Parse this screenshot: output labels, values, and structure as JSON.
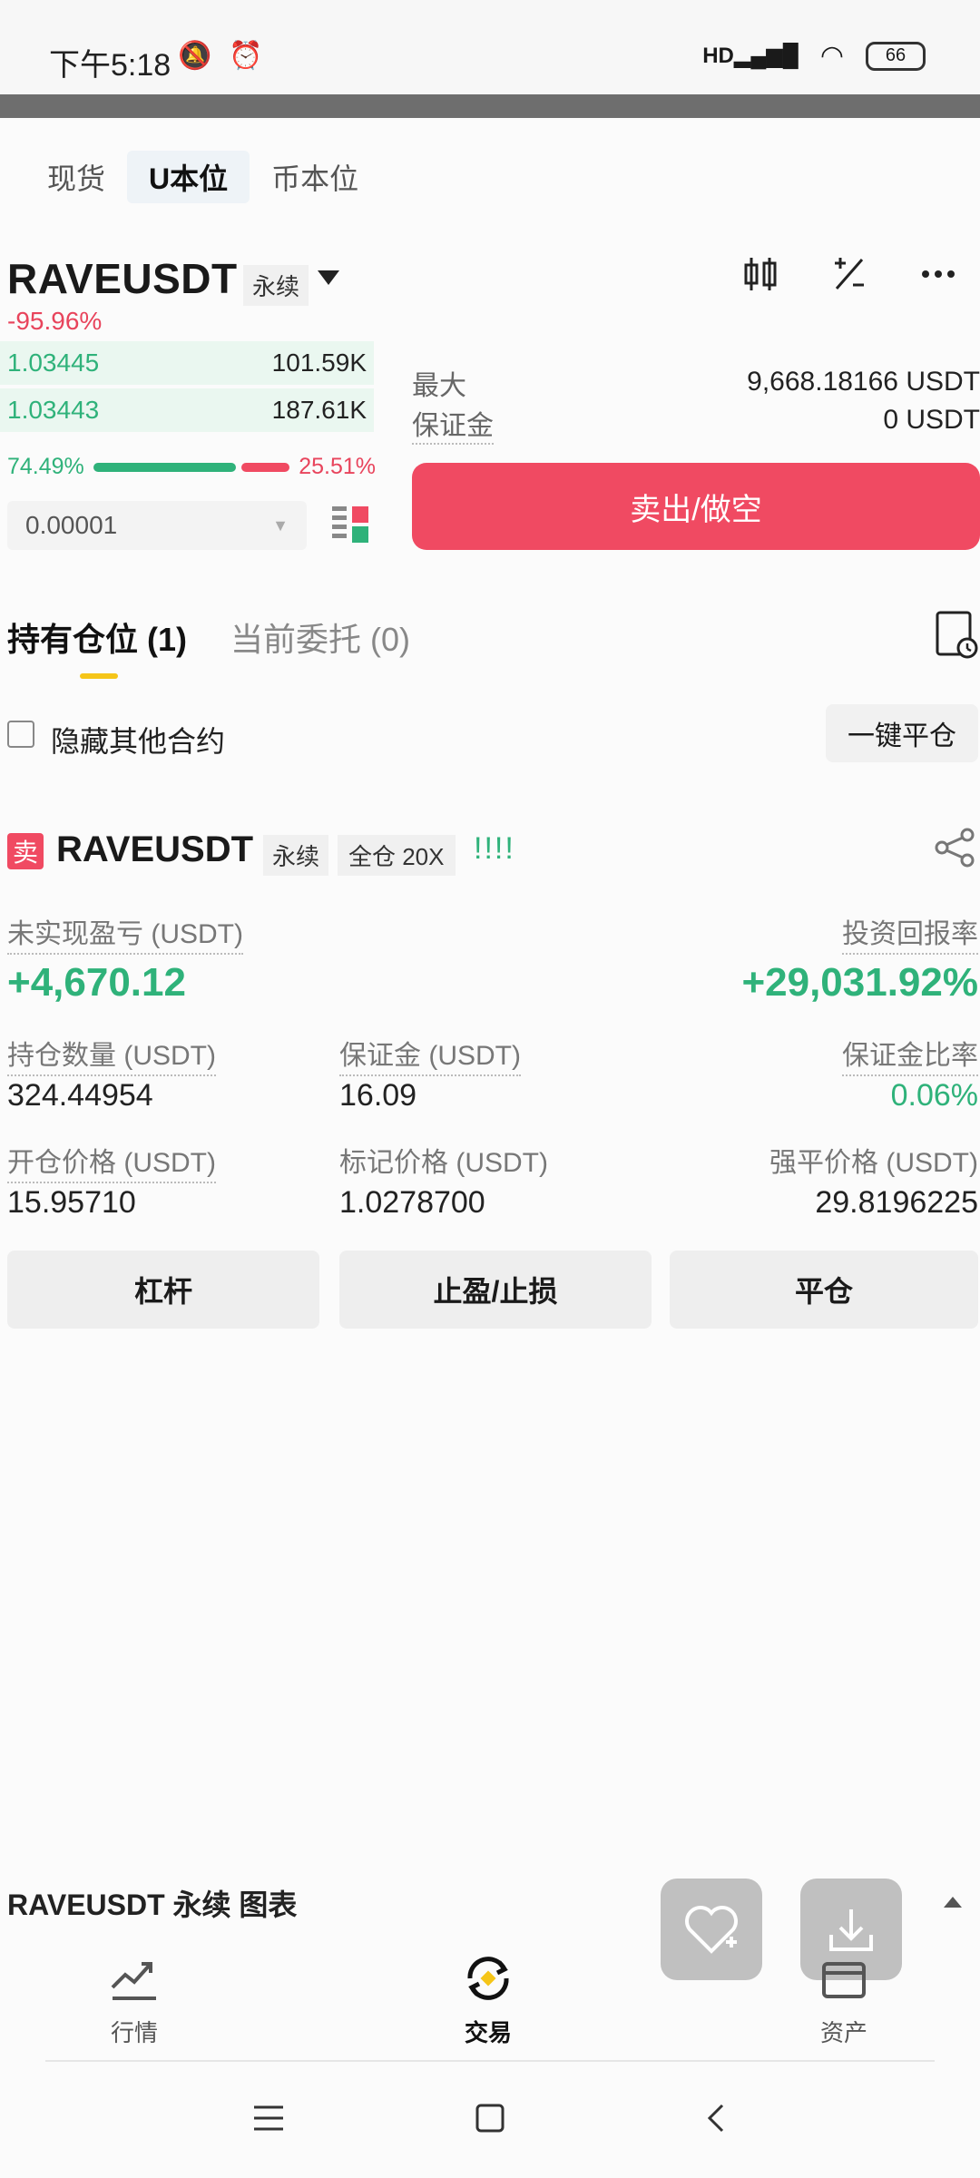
{
  "status_bar": {
    "time": "下午5:18",
    "battery": "66",
    "network": "HD"
  },
  "market_tabs": [
    "现货",
    "U本位",
    "币本位"
  ],
  "pair": {
    "symbol": "RAVEUSDT",
    "type_tag": "永续",
    "change": "-95.96%"
  },
  "orderbook": {
    "rows": [
      {
        "price": "1.03445",
        "qty": "101.59K"
      },
      {
        "price": "1.03443",
        "qty": "187.61K"
      }
    ],
    "buy_ratio": "74.49%",
    "sell_ratio": "25.51%",
    "buy_fraction": 0.7449,
    "precision": "0.00001"
  },
  "order_panel": {
    "max_label": "最大",
    "max_value": "9,668.18166 USDT",
    "margin_label": "保证金",
    "margin_value": "0 USDT",
    "sell_button": "卖出/做空"
  },
  "position_tabs": {
    "positions": "持有仓位 (1)",
    "orders": "当前委托 (0)"
  },
  "hide_others_label": "隐藏其他合约",
  "close_all_button": "一键平仓",
  "position": {
    "side_badge": "卖",
    "symbol": "RAVEUSDT",
    "type_tag": "永续",
    "margin_mode_tag": "全仓 20X",
    "risk_bars": "!!!!",
    "unrealized_pnl_label": "未实现盈亏 (USDT)",
    "unrealized_pnl": "+4,670.12",
    "roi_label": "投资回报率",
    "roi": "+29,031.92%",
    "size_label": "持仓数量 (USDT)",
    "size": "324.44954",
    "margin_label": "保证金 (USDT)",
    "margin": "16.09",
    "margin_ratio_label": "保证金比率",
    "margin_ratio": "0.06%",
    "entry_price_label": "开仓价格 (USDT)",
    "entry_price": "15.95710",
    "mark_price_label": "标记价格 (USDT)",
    "mark_price": "1.0278700",
    "liq_price_label": "强平价格 (USDT)",
    "liq_price": "29.8196225",
    "buttons": [
      "杠杆",
      "止盈/止损",
      "平仓"
    ]
  },
  "chart_bar_label": "RAVEUSDT 永续 图表",
  "bottom_nav": [
    "行情",
    "交易",
    "资产"
  ],
  "colors": {
    "green": "#2fb27a",
    "red": "#f04a62",
    "accent_yellow": "#f5c518"
  }
}
